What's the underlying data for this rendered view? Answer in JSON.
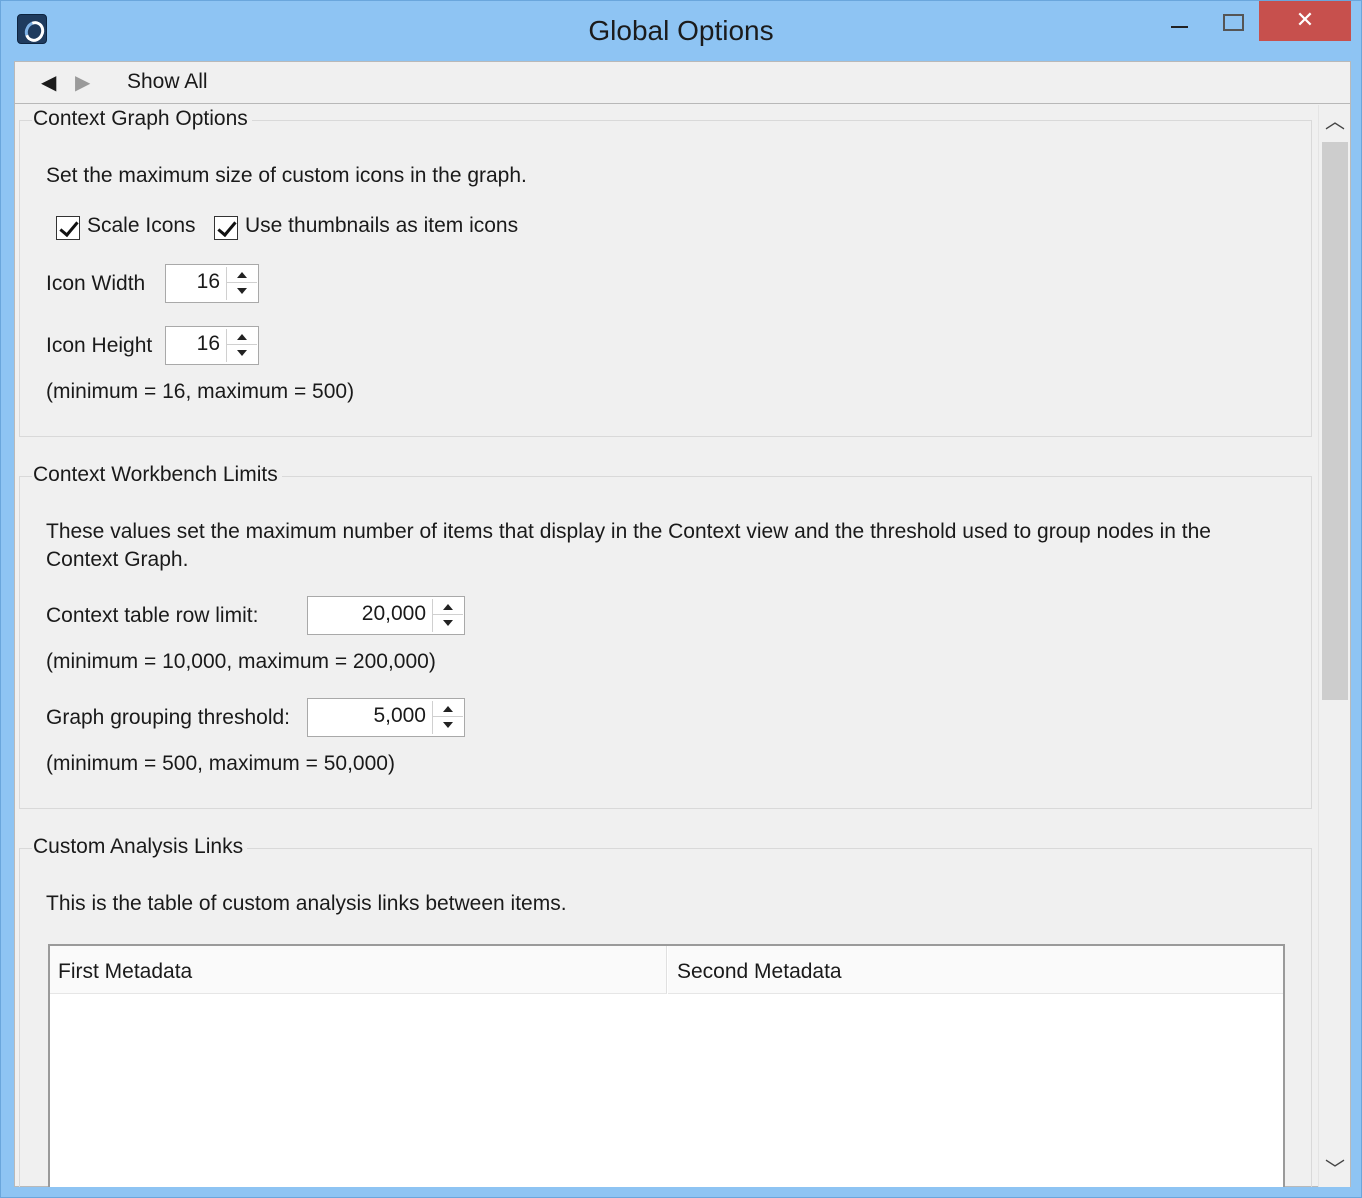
{
  "window": {
    "title": "Global Options",
    "close_glyph": "✕",
    "app_icon": "app-logo-icon"
  },
  "toolbar": {
    "back_glyph": "◀",
    "forward_glyph": "▶",
    "show_all_label": "Show All"
  },
  "scrollbar": {
    "up_glyph": "︿",
    "down_glyph": "﹀"
  },
  "context_graph": {
    "title": "Context Graph Options",
    "description": "Set the maximum size of custom icons in the graph.",
    "scale_icons_label": "Scale Icons",
    "scale_icons_checked": true,
    "thumbnails_label": "Use thumbnails as item icons",
    "thumbnails_checked": true,
    "icon_width_label": "Icon Width",
    "icon_width_value": "16",
    "icon_height_label": "Icon Height",
    "icon_height_value": "16",
    "range_note": "(minimum = 16, maximum = 500)"
  },
  "workbench_limits": {
    "title": "Context Workbench Limits",
    "description_line1": "These values set the maximum number of items that display in the Context view and the threshold used to group nodes in the",
    "description_line2": "Context Graph.",
    "row_limit_label": "Context table row limit:",
    "row_limit_value": "20,000",
    "row_limit_note": "(minimum = 10,000, maximum = 200,000)",
    "grouping_label": "Graph grouping threshold:",
    "grouping_value": "5,000",
    "grouping_note": "(minimum = 500, maximum = 50,000)"
  },
  "analysis_links": {
    "title": "Custom Analysis Links",
    "description": "This is the table of custom analysis links between items.",
    "columns": [
      "First Metadata",
      "Second Metadata"
    ]
  }
}
